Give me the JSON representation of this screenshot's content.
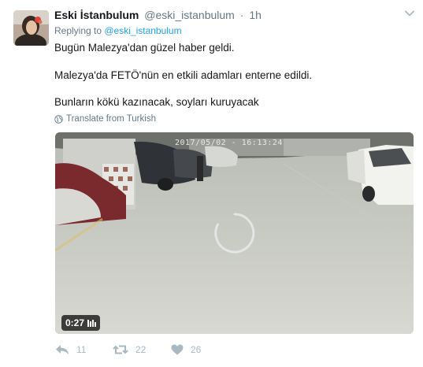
{
  "tweet": {
    "author_name": "Eski İstanbulum",
    "author_handle": "@eski_istanbulum",
    "separator": "·",
    "time": "1h",
    "replying_prefix": "Replying to ",
    "replying_handle": "@eski_istanbulum",
    "lines": [
      "Bugün Malezya'dan güzel haber geldi.",
      "Malezya'da FETÖ'nün en etkili adamları enterne edildi.",
      "Bunların kökü kazınacak, soyları kuruyacak"
    ],
    "translate_label": "Translate from Turkish"
  },
  "video": {
    "timestamp_overlay": "2017/05/02 - 16:13:24",
    "duration": "0:27"
  },
  "stats": {
    "replies": "11",
    "retweets": "22",
    "likes": "26"
  },
  "colors": {
    "link": "#1da1f2",
    "secondary_text": "#657786",
    "action_icon": "#aab8c2"
  },
  "icons": {
    "caret": "chevron-down-icon",
    "globe": "globe-icon",
    "reply": "reply-icon",
    "retweet": "retweet-icon",
    "like": "heart-icon",
    "loading": "loading-spinner-icon",
    "volume": "volume-bars-icon"
  }
}
